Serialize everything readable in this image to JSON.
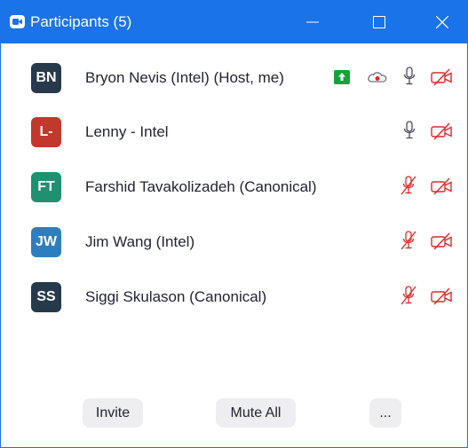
{
  "window": {
    "title": "Participants (5)"
  },
  "participants": [
    {
      "initials": "BN",
      "name": "Bryon Nevis (Intel) (Host, me)",
      "avatar_color": "#27394b",
      "mic": "on",
      "video": "off",
      "sharing": true,
      "recording": true
    },
    {
      "initials": "L-",
      "name": "Lenny - Intel",
      "avatar_color": "#c2382c",
      "mic": "on",
      "video": "off"
    },
    {
      "initials": "FT",
      "name": "Farshid Tavakolizadeh (Canonical)",
      "avatar_color": "#1f9070",
      "mic": "muted",
      "video": "off"
    },
    {
      "initials": "JW",
      "name": "Jim Wang (Intel)",
      "avatar_color": "#2e7ebe",
      "mic": "muted",
      "video": "off"
    },
    {
      "initials": "SS",
      "name": "Siggi Skulason (Canonical)",
      "avatar_color": "#27394b",
      "mic": "muted",
      "video": "off"
    }
  ],
  "footer": {
    "invite_label": "Invite",
    "mute_all_label": "Mute All",
    "more_label": "..."
  },
  "colors": {
    "titlebar": "#1a73e8",
    "muted_red": "#e02828",
    "share_green": "#14a33a"
  }
}
